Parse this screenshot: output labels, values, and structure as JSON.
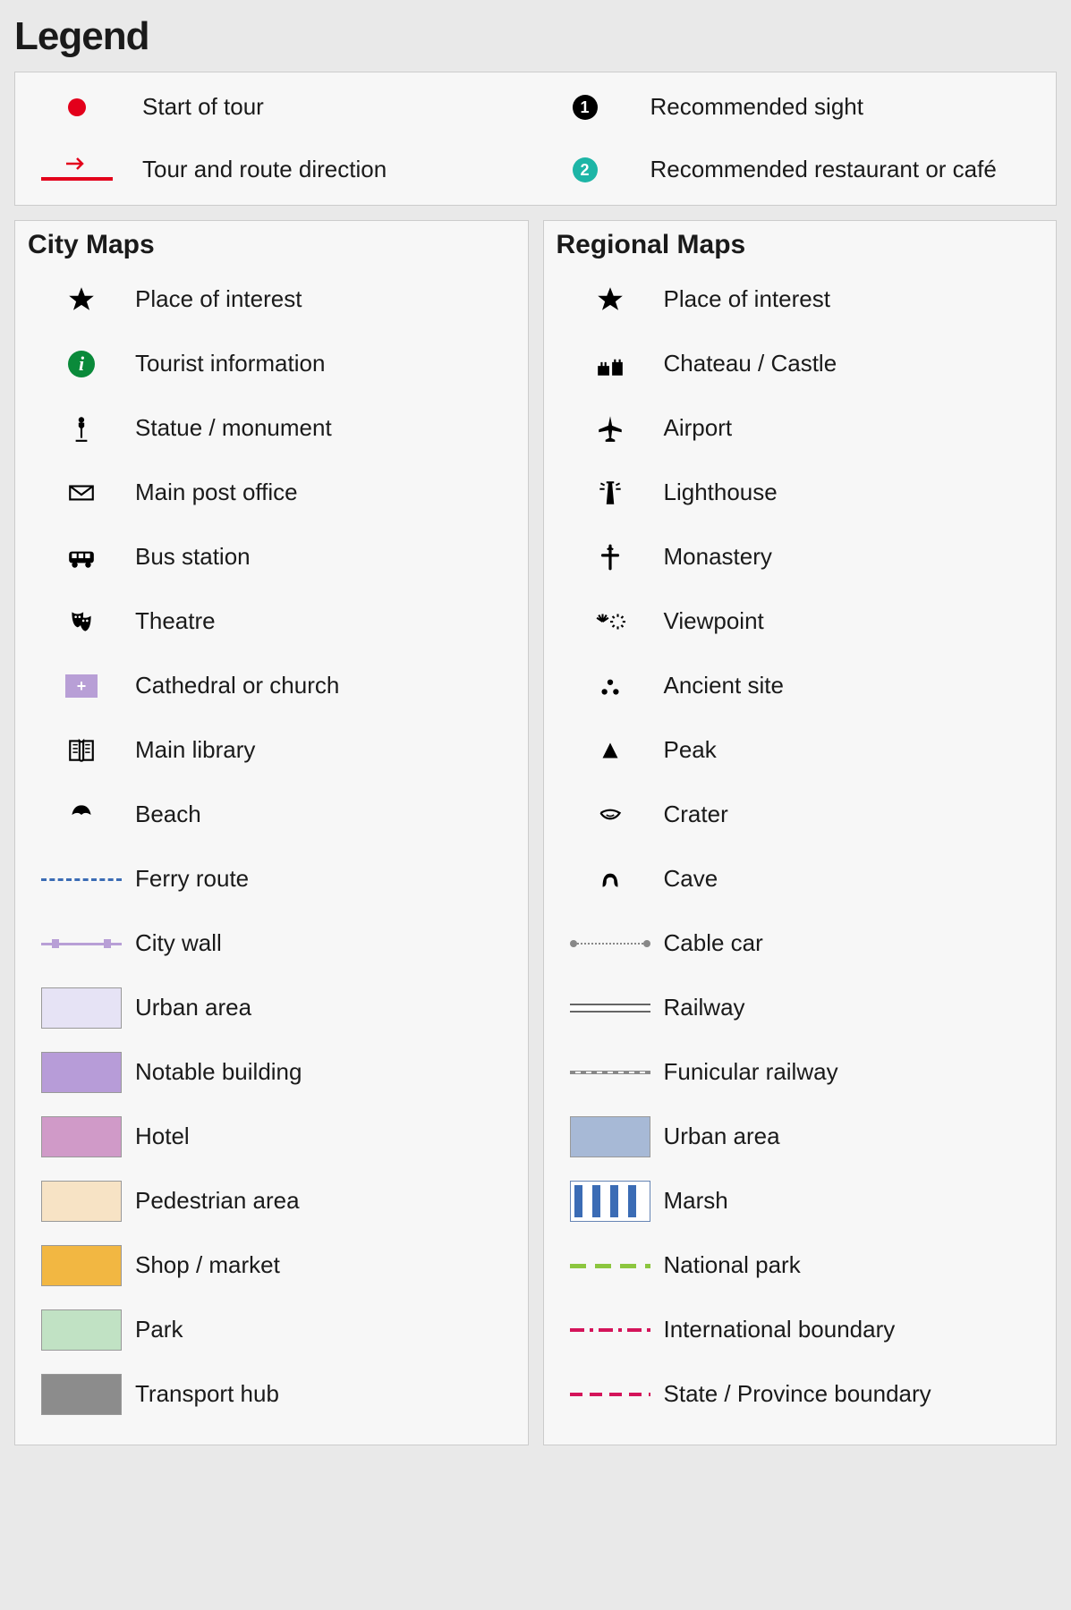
{
  "title": "Legend",
  "top": {
    "left": [
      {
        "label": "Start of tour"
      },
      {
        "label": "Tour and route direction"
      }
    ],
    "right": [
      {
        "num": "1",
        "color": "#000000",
        "label": "Recommended sight"
      },
      {
        "num": "2",
        "color": "#1db5a6",
        "label": "Recommended restaurant or café"
      }
    ]
  },
  "city": {
    "title": "City Maps",
    "items": [
      {
        "icon": "star",
        "label": "Place of interest"
      },
      {
        "icon": "info",
        "label": "Tourist information"
      },
      {
        "icon": "statue",
        "label": "Statue / monument"
      },
      {
        "icon": "post",
        "label": "Main post office"
      },
      {
        "icon": "bus",
        "label": "Bus station"
      },
      {
        "icon": "theatre",
        "label": "Theatre"
      },
      {
        "icon": "church",
        "label": "Cathedral or church"
      },
      {
        "icon": "library",
        "label": "Main library"
      },
      {
        "icon": "beach",
        "label": "Beach"
      },
      {
        "icon": "ferry",
        "label": "Ferry route"
      },
      {
        "icon": "citywall",
        "label": "City wall"
      },
      {
        "icon": "swatch",
        "color": "#e6e3f5",
        "label": "Urban area"
      },
      {
        "icon": "swatch",
        "color": "#b79cd8",
        "label": "Notable building"
      },
      {
        "icon": "swatch",
        "color": "#d09ac8",
        "label": "Hotel"
      },
      {
        "icon": "swatch",
        "color": "#f7e3c5",
        "label": "Pedestrian area"
      },
      {
        "icon": "swatch",
        "color": "#f2b742",
        "label": "Shop / market"
      },
      {
        "icon": "swatch",
        "color": "#c1e2c4",
        "label": "Park"
      },
      {
        "icon": "swatch",
        "color": "#8c8c8c",
        "label": "Transport hub"
      }
    ]
  },
  "regional": {
    "title": "Regional Maps",
    "items": [
      {
        "icon": "star",
        "label": "Place of interest"
      },
      {
        "icon": "castle",
        "label": "Chateau / Castle"
      },
      {
        "icon": "airport",
        "label": "Airport"
      },
      {
        "icon": "lighthouse",
        "label": "Lighthouse"
      },
      {
        "icon": "monastery",
        "label": "Monastery"
      },
      {
        "icon": "viewpoint",
        "label": "Viewpoint"
      },
      {
        "icon": "ancient",
        "label": "Ancient site"
      },
      {
        "icon": "peak",
        "label": "Peak"
      },
      {
        "icon": "crater",
        "label": "Crater"
      },
      {
        "icon": "cave",
        "label": "Cave"
      },
      {
        "icon": "cablecar",
        "label": "Cable car"
      },
      {
        "icon": "railway",
        "label": "Railway"
      },
      {
        "icon": "funicular",
        "label": "Funicular railway"
      },
      {
        "icon": "swatch",
        "color": "#a7b9d6",
        "label": "Urban area"
      },
      {
        "icon": "marsh",
        "label": "Marsh"
      },
      {
        "icon": "natpark",
        "label": "National park"
      },
      {
        "icon": "intl",
        "label": "International boundary"
      },
      {
        "icon": "state",
        "label": "State / Province boundary"
      }
    ]
  }
}
